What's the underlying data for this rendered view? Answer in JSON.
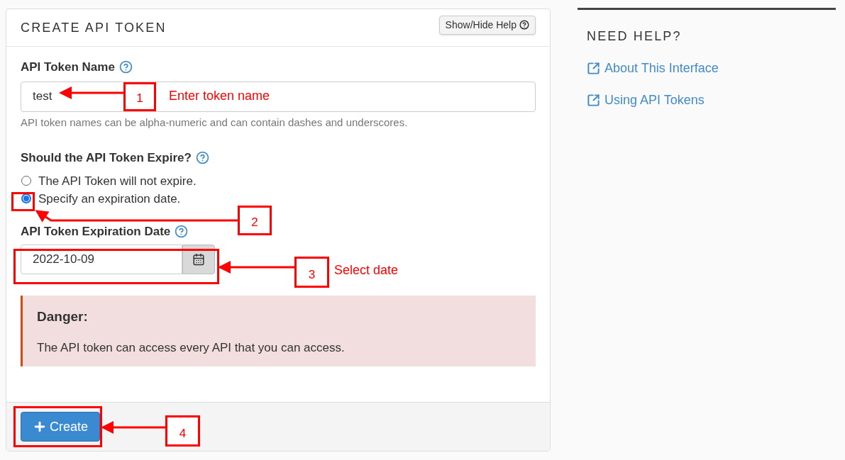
{
  "panel": {
    "title": "CREATE API TOKEN",
    "help_button": "Show/Hide Help"
  },
  "name_field": {
    "label": "API Token Name",
    "value": "test",
    "hint": "API token names can be alpha-numeric and can contain dashes and underscores."
  },
  "expire": {
    "label": "Should the API Token Expire?",
    "options": [
      {
        "label": "The API Token will not expire.",
        "selected": false
      },
      {
        "label": "Specify an expiration date.",
        "selected": true
      }
    ]
  },
  "date_field": {
    "label": "API Token Expiration Date",
    "value": "2022-10-09"
  },
  "alert": {
    "title": "Danger:",
    "text": "The API token can access every API that you can access."
  },
  "create_button": "Create",
  "help": {
    "title": "NEED HELP?",
    "links": [
      "About This Interface",
      "Using API Tokens"
    ]
  },
  "annotations": [
    {
      "number": "1",
      "note": "Enter token name"
    },
    {
      "number": "2"
    },
    {
      "number": "3",
      "note": "Select date"
    },
    {
      "number": "4"
    }
  ]
}
